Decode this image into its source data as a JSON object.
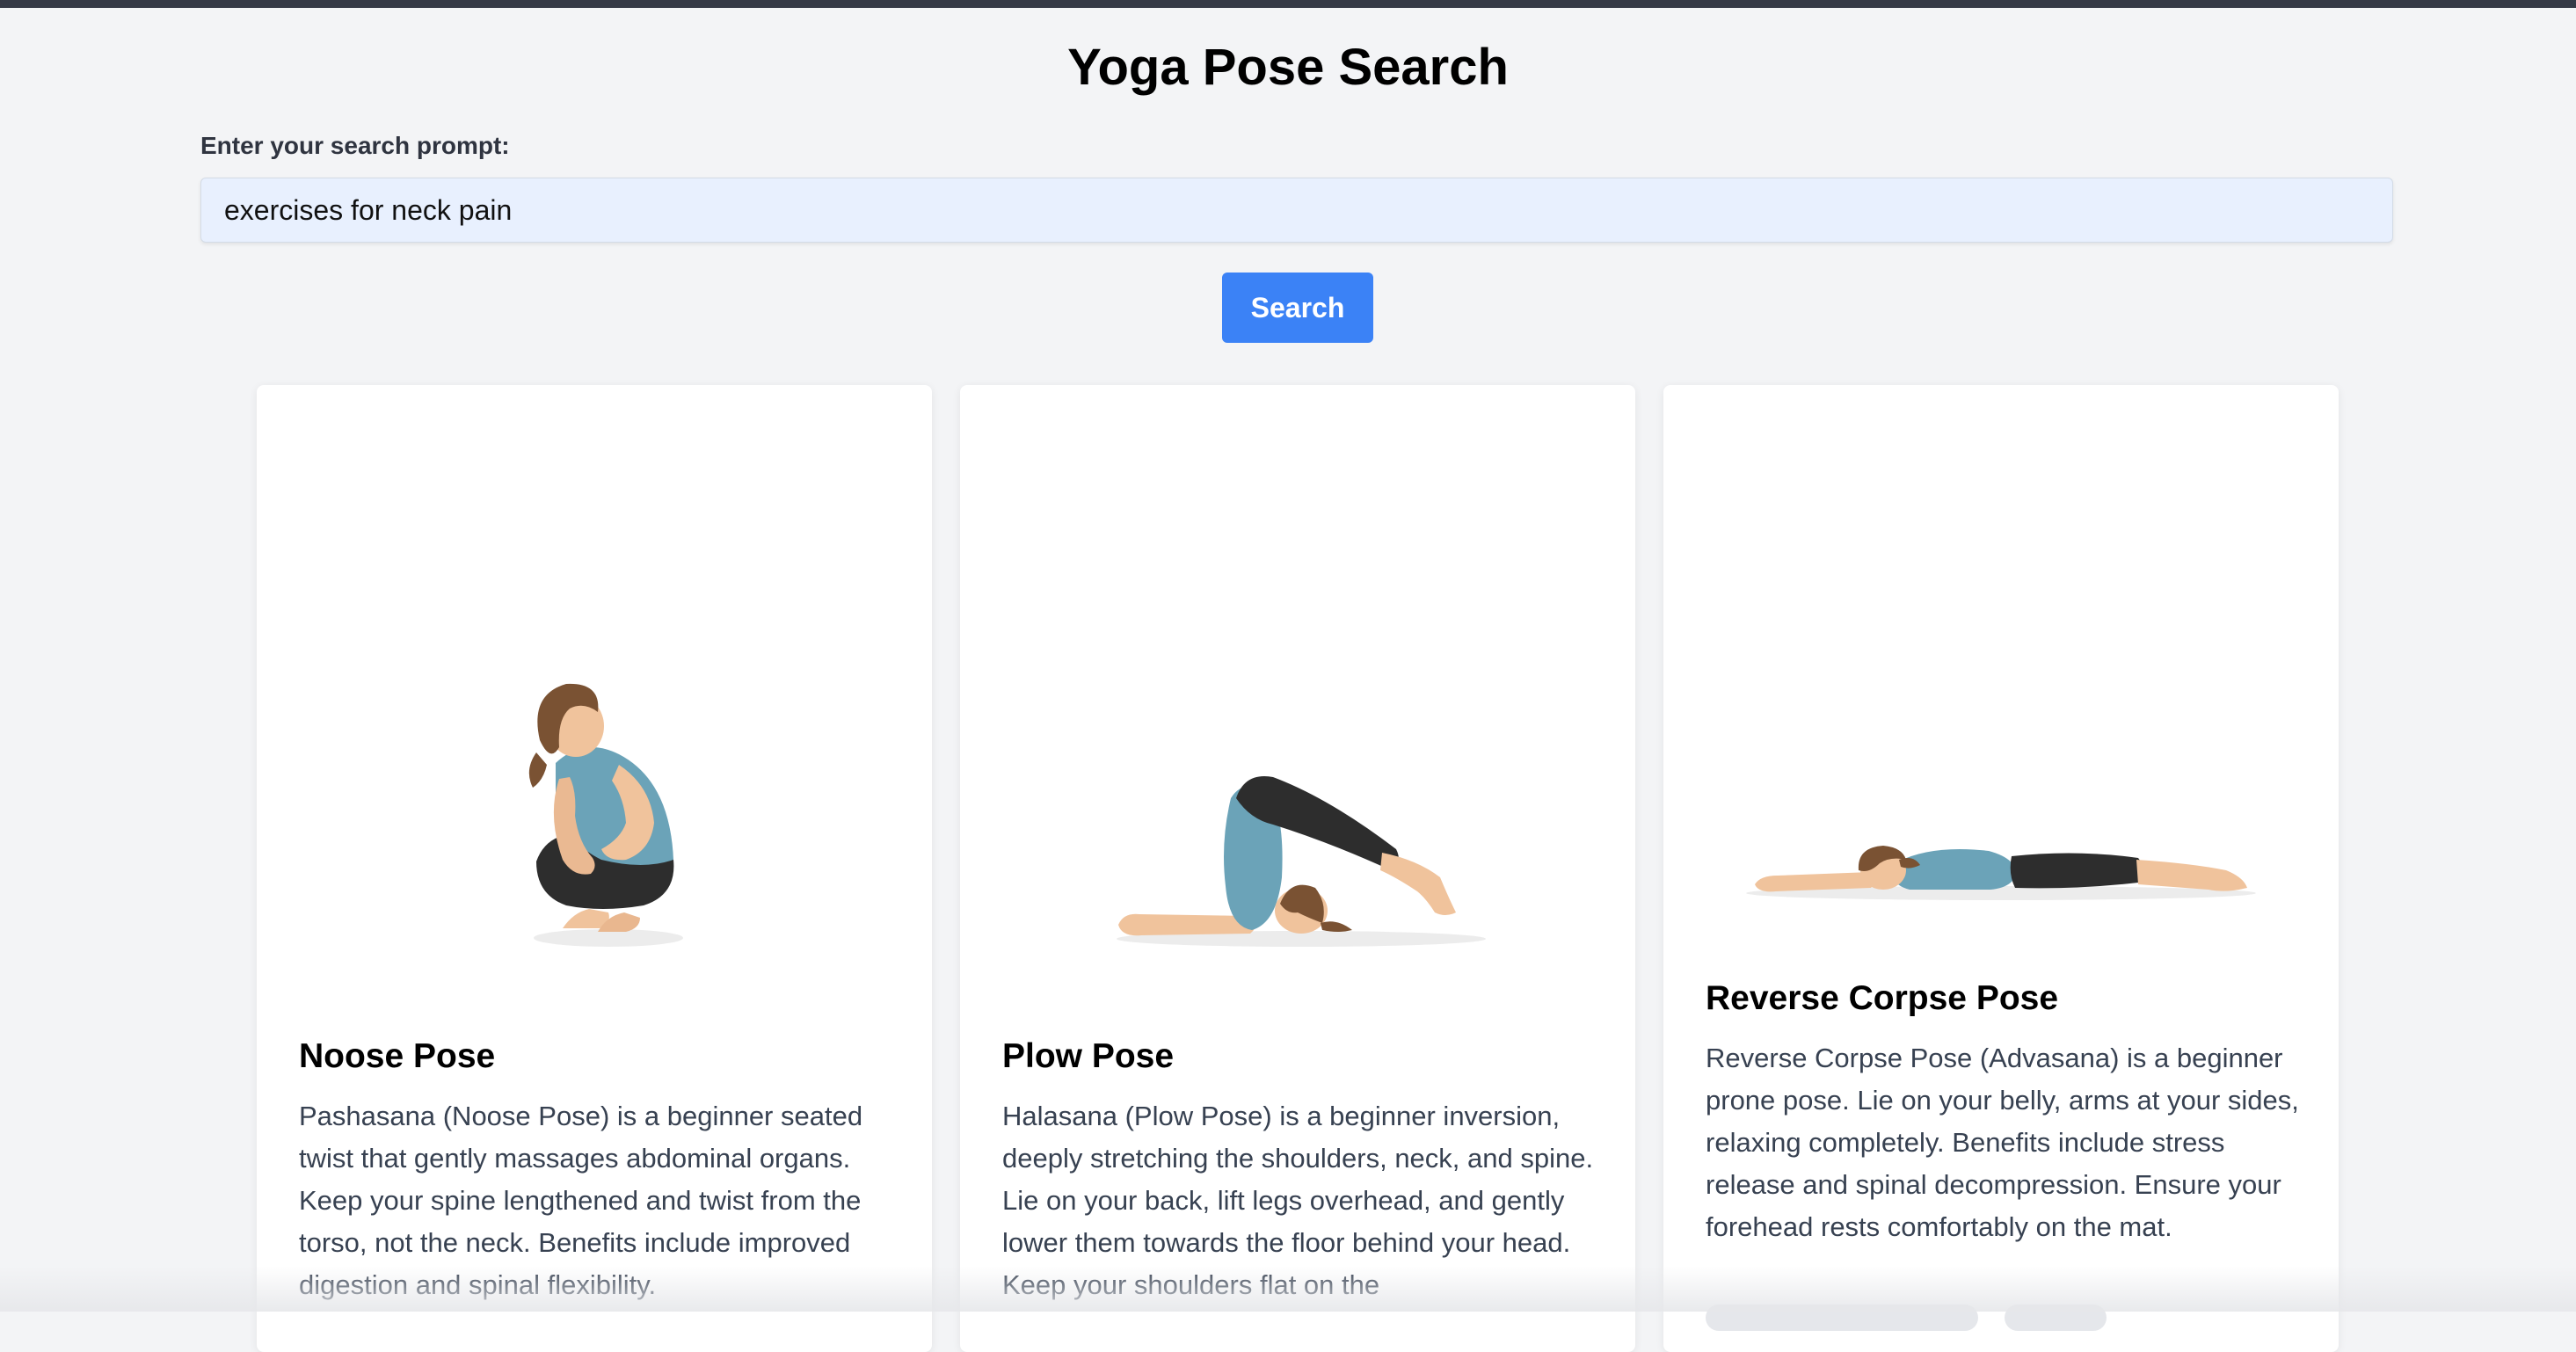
{
  "page": {
    "title": "Yoga Pose Search"
  },
  "search": {
    "label": "Enter your search prompt:",
    "value": "exercises for neck pain",
    "button_label": "Search"
  },
  "results": [
    {
      "title": "Noose Pose",
      "description": "Pashasana (Noose Pose) is a beginner seated twist that gently massages abdominal organs. Keep your spine lengthened and twist from the torso, not the neck. Benefits include improved digestion and spinal flexibility."
    },
    {
      "title": "Plow Pose",
      "description": "Halasana (Plow Pose) is a beginner inversion, deeply stretching the shoulders, neck, and spine. Lie on your back, lift legs overhead, and gently lower them towards the floor behind your head. Keep your shoulders flat on the"
    },
    {
      "title": "Reverse Corpse Pose",
      "description": "Reverse Corpse Pose (Advasana) is a beginner prone pose. Lie on your belly, arms at your sides, relaxing completely. Benefits include stress release and spinal decompression. Ensure your forehead rests comfortably on the mat."
    }
  ],
  "colors": {
    "accent": "#3b82f6",
    "background": "#f3f4f6",
    "topbar": "#353a46",
    "top_color": "#6ba3b8",
    "pants_color": "#2d2d2d",
    "skin_color": "#f0c39c",
    "hair_color": "#7a5233"
  }
}
